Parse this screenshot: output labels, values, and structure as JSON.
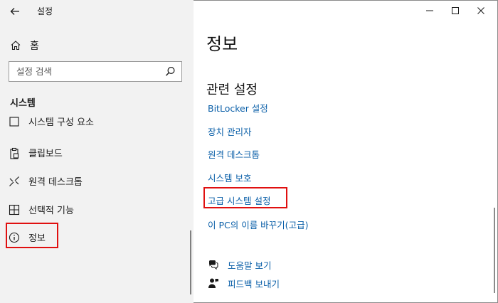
{
  "window": {
    "title": "설정",
    "controls": [
      "minimize-icon",
      "maximize-icon",
      "close-icon"
    ]
  },
  "sidebar": {
    "home_label": "홈",
    "search_placeholder": "설정 검색",
    "section_title": "시스템",
    "items": [
      {
        "label": "시스템 구성 요소",
        "icon": "system-components-icon",
        "partially_visible": true
      },
      {
        "label": "클립보드",
        "icon": "clipboard-icon"
      },
      {
        "label": "원격 데스크톱",
        "icon": "remote-desktop-icon"
      },
      {
        "label": "선택적 기능",
        "icon": "optional-features-icon"
      },
      {
        "label": "정보",
        "icon": "info-icon",
        "selected": true
      }
    ]
  },
  "main": {
    "title": "정보",
    "related_title": "관련 설정",
    "links": [
      {
        "label": "BitLocker 설정"
      },
      {
        "label": "장치 관리자"
      },
      {
        "label": "원격 데스크톱"
      },
      {
        "label": "시스템 보호"
      },
      {
        "label": "고급 시스템 설정",
        "highlighted": true
      },
      {
        "label": "이 PC의 이름 바꾸기(고급)"
      }
    ],
    "help": [
      {
        "label": "도움말 보기",
        "icon": "help-chat-icon"
      },
      {
        "label": "피드백 보내기",
        "icon": "feedback-icon"
      }
    ]
  },
  "colors": {
    "link": "#0a5fa8",
    "highlight_box": "#e01010",
    "sidebar_bg": "#f2f2f2",
    "selected_marker": "#1a1a1a"
  }
}
